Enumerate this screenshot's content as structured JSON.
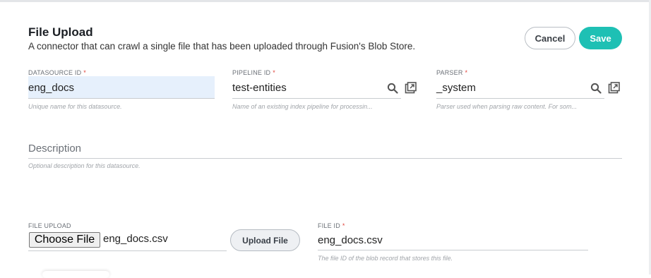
{
  "header": {
    "title": "File Upload",
    "subtitle": "A connector that can crawl a single file that has been uploaded through Fusion's Blob Store.",
    "cancel_label": "Cancel",
    "save_label": "Save"
  },
  "fields": {
    "datasource_id": {
      "label": "DATASOURCE ID",
      "required_mark": "*",
      "value": "eng_docs",
      "hint": "Unique name for this datasource."
    },
    "pipeline_id": {
      "label": "PIPELINE ID",
      "required_mark": "*",
      "value": "test-entities",
      "hint": "Name of an existing index pipeline for processin..."
    },
    "parser": {
      "label": "PARSER",
      "required_mark": "*",
      "value": "_system",
      "hint": "Parser used when parsing raw content. For som..."
    },
    "description": {
      "placeholder": "Description",
      "hint": "Optional description for this datasource."
    },
    "file_upload": {
      "label": "FILE UPLOAD",
      "choose_label": "Choose File",
      "chosen_file": "eng_docs.csv",
      "upload_label": "Upload File"
    },
    "file_id": {
      "label": "FILE ID",
      "required_mark": "*",
      "value": "eng_docs.csv",
      "hint": "The file ID of the blob record that stores this file."
    }
  },
  "icons": {
    "search": "search-icon",
    "open_external": "open-external-icon"
  },
  "colors": {
    "accent": "#1ec0b4",
    "required": "#e0443b",
    "filled_bg": "#e6f0fc"
  }
}
